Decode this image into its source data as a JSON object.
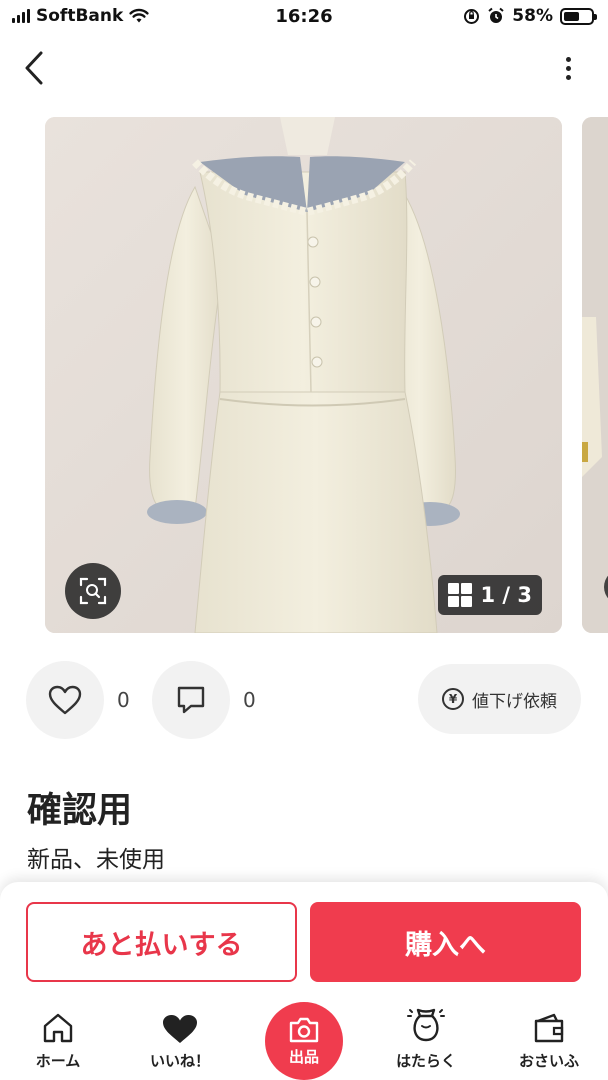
{
  "status_bar": {
    "carrier": "SoftBank",
    "time": "16:26",
    "battery": "58%",
    "battery_level": 0.58
  },
  "nav": {
    "back_icon": "chevron-left-icon",
    "more_icon": "more-vertical-icon"
  },
  "gallery": {
    "counter": "1 / 3",
    "current": 1,
    "total": 3
  },
  "actions": {
    "like_count": "0",
    "comment_count": "0",
    "price_down_label": "値下げ依頼"
  },
  "product": {
    "title": "確認用",
    "condition": "新品、未使用"
  },
  "purchase": {
    "pay_later_label": "あと払いする",
    "buy_label": "購入へ"
  },
  "tabs": [
    {
      "label": "ホーム",
      "icon": "home-icon"
    },
    {
      "label": "いいね！",
      "icon": "heart-icon"
    },
    {
      "label": "出品",
      "icon": "camera-icon"
    },
    {
      "label": "はたらく",
      "icon": "money-bag-icon"
    },
    {
      "label": "おさいふ",
      "icon": "wallet-icon"
    }
  ],
  "colors": {
    "accent": "#f03c4e",
    "accent_outline": "#e8364a"
  }
}
